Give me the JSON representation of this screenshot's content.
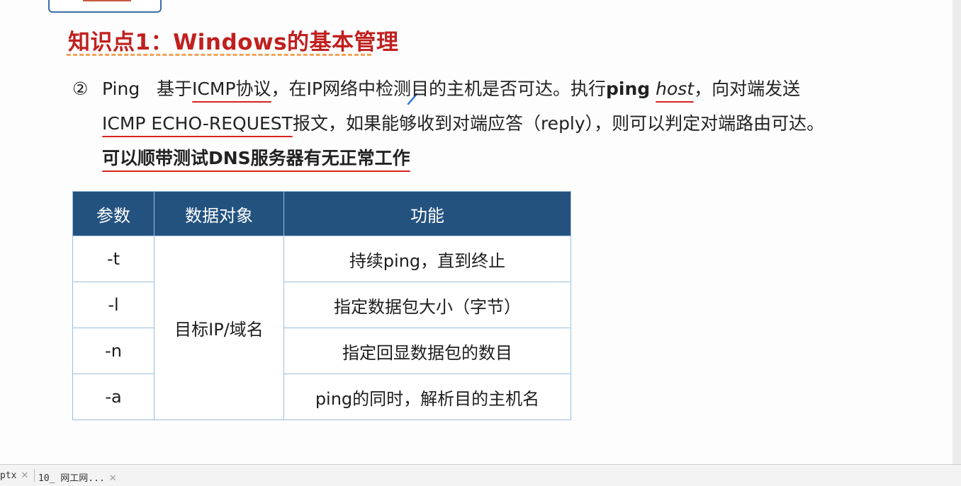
{
  "slide": {
    "title": "知识点1：Windows的基本管理",
    "bullet": "②",
    "para": {
      "l1_ping": "Ping",
      "l1_based": "基于",
      "l1_icmp": "ICMP协议",
      "l1_rest": "，在IP网络中检测目的主机是否可达。执行",
      "l1_cmd": "ping",
      "l1_host": "host",
      "l1_comma": "，",
      "l1_tail": "向对端发送",
      "l2_echo": "ICMP ECHO-REQUEST",
      "l2_rest": "报文，如果能够收到对端应答（reply），则可以判定对端路由可达。",
      "l3": "可以顺带测试DNS服务器有无正常工作"
    },
    "table": {
      "headers": [
        "参数",
        "数据对象",
        "功能"
      ],
      "shared_object": "目标IP/域名",
      "rows": [
        {
          "param": "-t",
          "function": "持续ping，直到终止"
        },
        {
          "param": "-l",
          "function": "指定数据包大小（字节）"
        },
        {
          "param": "-n",
          "function": "指定回显数据包的数目"
        },
        {
          "param": "-a",
          "function": "ping的同时，解析目的主机名"
        }
      ]
    }
  },
  "tabs": [
    {
      "label": "ptx",
      "close": "✕"
    },
    {
      "label": "10_ 网工网...",
      "close": "✕"
    }
  ],
  "colors": {
    "title": "#c0201f",
    "title_rule": "#f0a35a",
    "table_header": "#23527f",
    "table_border": "#9bbfe0",
    "annotation": "#d9231f"
  }
}
